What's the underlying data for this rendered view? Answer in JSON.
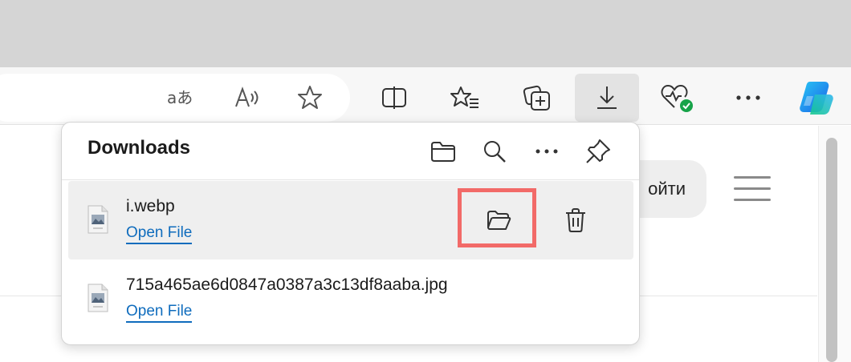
{
  "toolbar": {
    "icons": [
      "read-aloud-language-icon",
      "read-aloud-icon",
      "favorite-star-icon",
      "split-screen-icon",
      "favorites-list-icon",
      "collections-icon",
      "downloads-icon",
      "browser-essentials-icon",
      "more-icon",
      "copilot-icon"
    ]
  },
  "page": {
    "signin_label": "ойти"
  },
  "downloads": {
    "title": "Downloads",
    "header_icons": [
      "open-downloads-folder-icon",
      "search-icon",
      "more-options-icon",
      "pin-icon"
    ],
    "items": [
      {
        "file_name": "i.webp",
        "action_label": "Open File"
      },
      {
        "file_name": "715a465ae6d0847a0387a3c13df8aaba.jpg",
        "action_label": "Open File"
      }
    ]
  },
  "colors": {
    "link": "#0f6cbd",
    "highlight": "#f26a68",
    "tabstrip": "#d5d5d5",
    "copilot_blue": "#1a73e8",
    "health_green": "#17a349"
  }
}
